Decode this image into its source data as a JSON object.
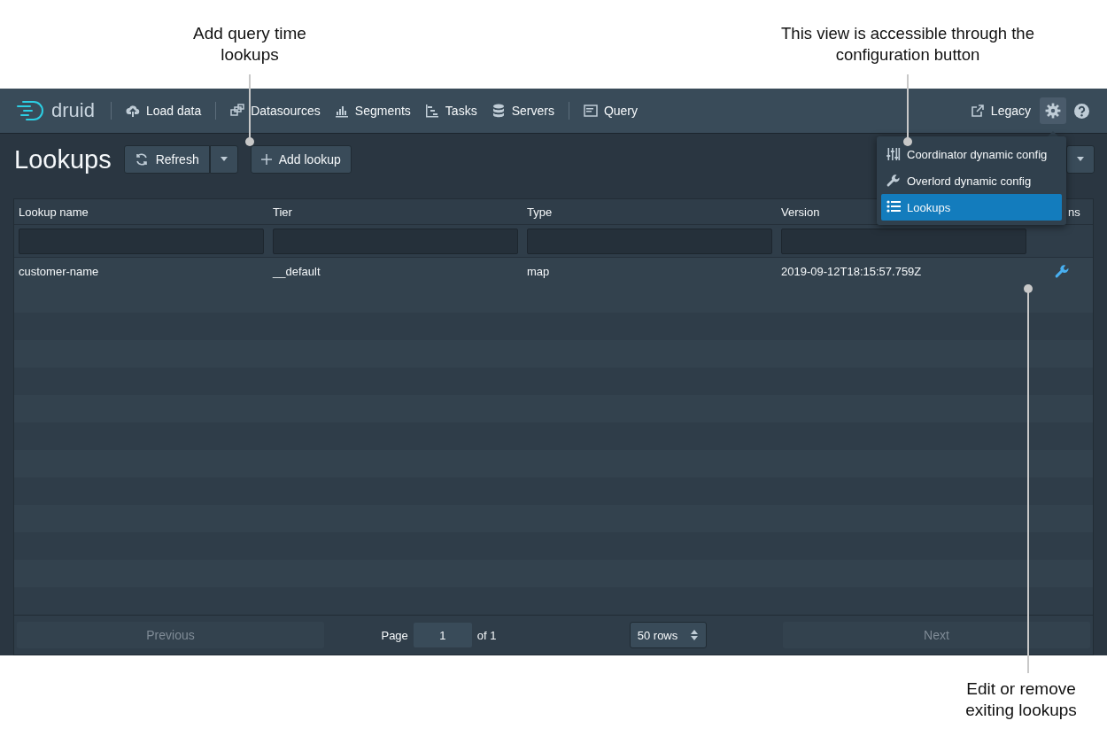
{
  "annotations": [
    {
      "text": "Add query time lookups"
    },
    {
      "text": "This view is accessible through the configuration button"
    },
    {
      "text": "Edit or remove exiting lookups"
    }
  ],
  "navbar": {
    "logo": "druid",
    "items": [
      {
        "label": "Load data"
      },
      {
        "label": "Datasources"
      },
      {
        "label": "Segments"
      },
      {
        "label": "Tasks"
      },
      {
        "label": "Servers"
      },
      {
        "label": "Query"
      }
    ],
    "legacy": "Legacy",
    "settings_open": true
  },
  "header": {
    "title": "Lookups",
    "refresh": "Refresh",
    "add": "Add lookup"
  },
  "settings_menu": [
    {
      "label": "Coordinator dynamic config",
      "selected": false
    },
    {
      "label": "Overlord dynamic config",
      "selected": false
    },
    {
      "label": "Lookups",
      "selected": true
    }
  ],
  "table": {
    "columns": [
      "Lookup name",
      "Tier",
      "Type",
      "Version",
      "ns"
    ],
    "rows": [
      {
        "name": "customer-name",
        "tier": "__default",
        "type": "map",
        "version": "2019-09-12T18:15:57.759Z"
      }
    ]
  },
  "pagination": {
    "previous": {
      "label": "Previous",
      "disabled": true
    },
    "page_label": "Page",
    "page": "1",
    "of": "of 1",
    "rows": "50 rows",
    "next": {
      "label": "Next",
      "disabled": true
    }
  }
}
